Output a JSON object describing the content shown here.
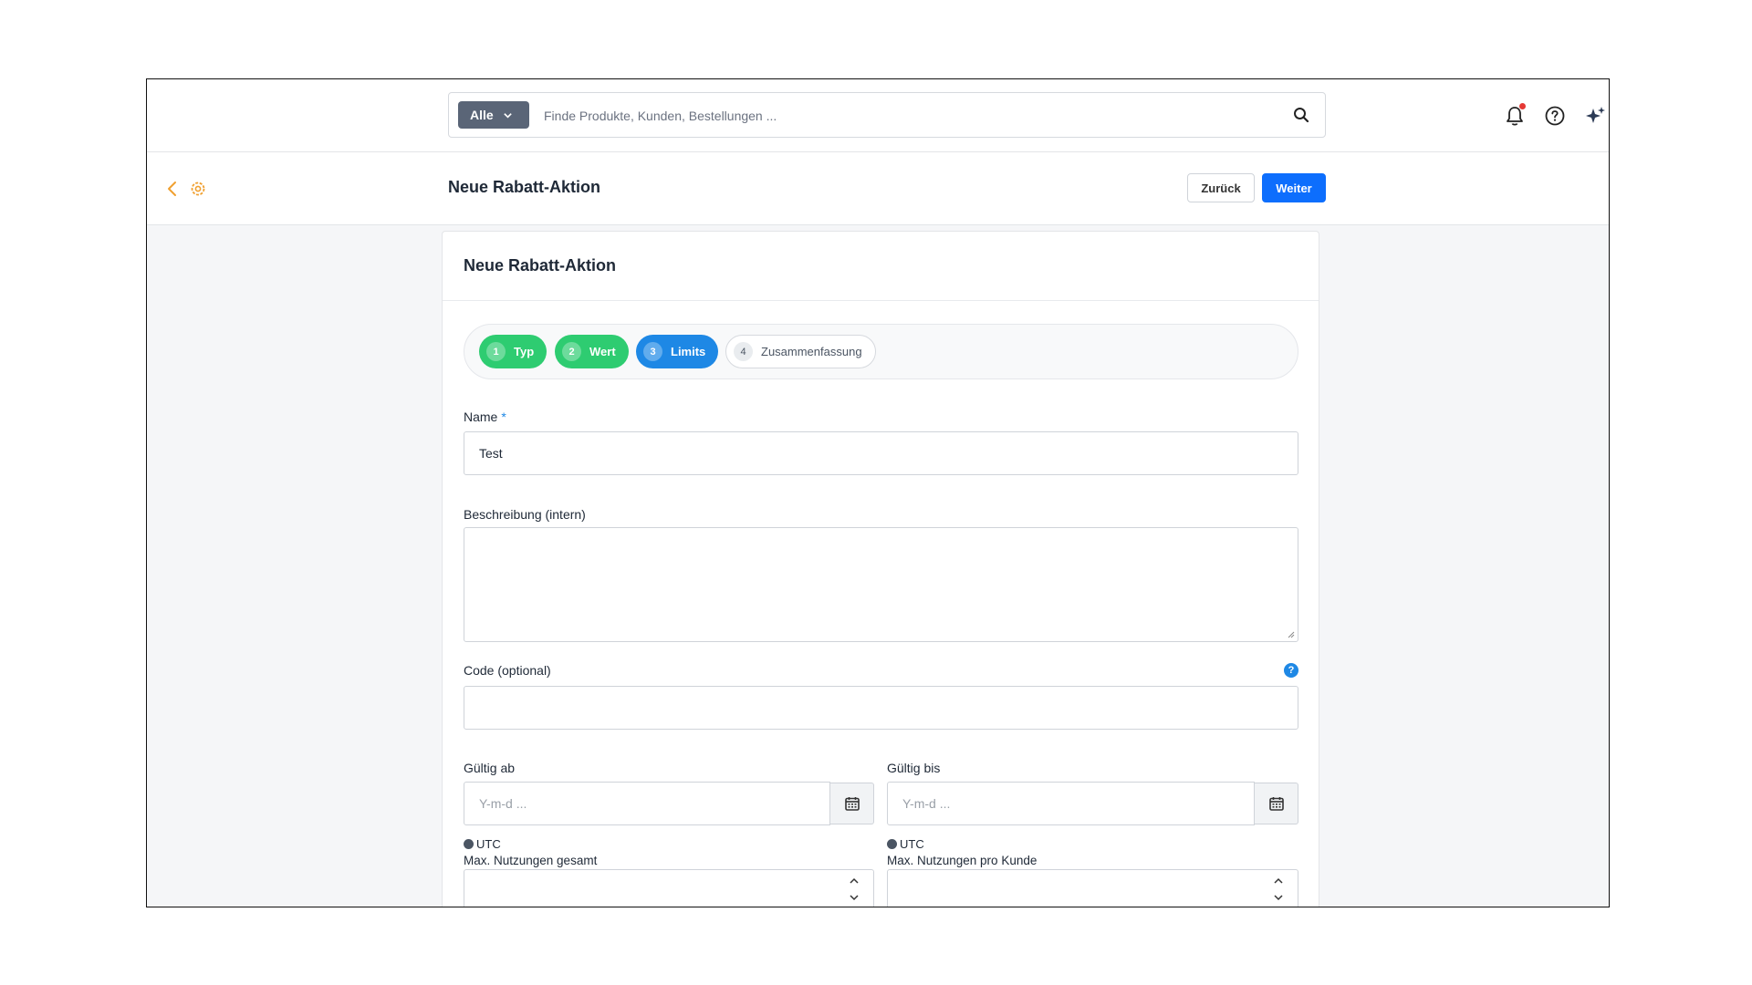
{
  "topbar": {
    "scope_label": "Alle",
    "search_placeholder": "Finde Produkte, Kunden, Bestellungen ...",
    "icons": [
      "bell-icon",
      "help-circle-icon",
      "sparkle-icon"
    ]
  },
  "header": {
    "title": "Neue Rabatt-Aktion",
    "back_button": "Zurück",
    "next_button": "Weiter"
  },
  "card": {
    "title": "Neue Rabatt-Aktion",
    "steps": [
      {
        "num": "1",
        "label": "Typ",
        "state": "done"
      },
      {
        "num": "2",
        "label": "Wert",
        "state": "done"
      },
      {
        "num": "3",
        "label": "Limits",
        "state": "active"
      },
      {
        "num": "4",
        "label": "Zusammenfassung",
        "state": "todo"
      }
    ],
    "fields": {
      "name_label": "Name",
      "name_required": "*",
      "name_value": "Test",
      "description_label": "Beschreibung (intern)",
      "description_value": "",
      "code_label": "Code (optional)",
      "code_value": "",
      "code_help": "?",
      "valid_from_label": "Gültig ab",
      "valid_from_placeholder": "Y-m-d ...",
      "valid_to_label": "Gültig bis",
      "valid_to_placeholder": "Y-m-d ...",
      "timezone_from": "UTC",
      "timezone_to": "UTC",
      "max_total_label": "Max. Nutzungen gesamt",
      "max_per_customer_label": "Max. Nutzungen pro Kunde"
    }
  },
  "colors": {
    "primary": "#0d6efd",
    "step_done": "#2ecc71",
    "step_active": "#1e88e5",
    "accent_orange": "#f0a030"
  }
}
